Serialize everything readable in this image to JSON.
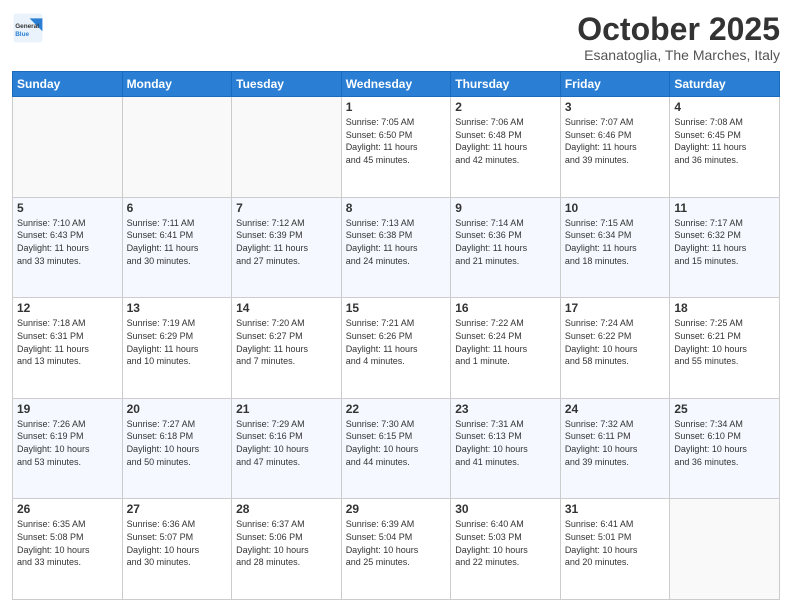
{
  "header": {
    "logo_general": "General",
    "logo_blue": "Blue",
    "month_title": "October 2025",
    "location": "Esanatoglia, The Marches, Italy"
  },
  "days_of_week": [
    "Sunday",
    "Monday",
    "Tuesday",
    "Wednesday",
    "Thursday",
    "Friday",
    "Saturday"
  ],
  "weeks": [
    [
      {
        "day": "",
        "info": ""
      },
      {
        "day": "",
        "info": ""
      },
      {
        "day": "",
        "info": ""
      },
      {
        "day": "1",
        "info": "Sunrise: 7:05 AM\nSunset: 6:50 PM\nDaylight: 11 hours\nand 45 minutes."
      },
      {
        "day": "2",
        "info": "Sunrise: 7:06 AM\nSunset: 6:48 PM\nDaylight: 11 hours\nand 42 minutes."
      },
      {
        "day": "3",
        "info": "Sunrise: 7:07 AM\nSunset: 6:46 PM\nDaylight: 11 hours\nand 39 minutes."
      },
      {
        "day": "4",
        "info": "Sunrise: 7:08 AM\nSunset: 6:45 PM\nDaylight: 11 hours\nand 36 minutes."
      }
    ],
    [
      {
        "day": "5",
        "info": "Sunrise: 7:10 AM\nSunset: 6:43 PM\nDaylight: 11 hours\nand 33 minutes."
      },
      {
        "day": "6",
        "info": "Sunrise: 7:11 AM\nSunset: 6:41 PM\nDaylight: 11 hours\nand 30 minutes."
      },
      {
        "day": "7",
        "info": "Sunrise: 7:12 AM\nSunset: 6:39 PM\nDaylight: 11 hours\nand 27 minutes."
      },
      {
        "day": "8",
        "info": "Sunrise: 7:13 AM\nSunset: 6:38 PM\nDaylight: 11 hours\nand 24 minutes."
      },
      {
        "day": "9",
        "info": "Sunrise: 7:14 AM\nSunset: 6:36 PM\nDaylight: 11 hours\nand 21 minutes."
      },
      {
        "day": "10",
        "info": "Sunrise: 7:15 AM\nSunset: 6:34 PM\nDaylight: 11 hours\nand 18 minutes."
      },
      {
        "day": "11",
        "info": "Sunrise: 7:17 AM\nSunset: 6:32 PM\nDaylight: 11 hours\nand 15 minutes."
      }
    ],
    [
      {
        "day": "12",
        "info": "Sunrise: 7:18 AM\nSunset: 6:31 PM\nDaylight: 11 hours\nand 13 minutes."
      },
      {
        "day": "13",
        "info": "Sunrise: 7:19 AM\nSunset: 6:29 PM\nDaylight: 11 hours\nand 10 minutes."
      },
      {
        "day": "14",
        "info": "Sunrise: 7:20 AM\nSunset: 6:27 PM\nDaylight: 11 hours\nand 7 minutes."
      },
      {
        "day": "15",
        "info": "Sunrise: 7:21 AM\nSunset: 6:26 PM\nDaylight: 11 hours\nand 4 minutes."
      },
      {
        "day": "16",
        "info": "Sunrise: 7:22 AM\nSunset: 6:24 PM\nDaylight: 11 hours\nand 1 minute."
      },
      {
        "day": "17",
        "info": "Sunrise: 7:24 AM\nSunset: 6:22 PM\nDaylight: 10 hours\nand 58 minutes."
      },
      {
        "day": "18",
        "info": "Sunrise: 7:25 AM\nSunset: 6:21 PM\nDaylight: 10 hours\nand 55 minutes."
      }
    ],
    [
      {
        "day": "19",
        "info": "Sunrise: 7:26 AM\nSunset: 6:19 PM\nDaylight: 10 hours\nand 53 minutes."
      },
      {
        "day": "20",
        "info": "Sunrise: 7:27 AM\nSunset: 6:18 PM\nDaylight: 10 hours\nand 50 minutes."
      },
      {
        "day": "21",
        "info": "Sunrise: 7:29 AM\nSunset: 6:16 PM\nDaylight: 10 hours\nand 47 minutes."
      },
      {
        "day": "22",
        "info": "Sunrise: 7:30 AM\nSunset: 6:15 PM\nDaylight: 10 hours\nand 44 minutes."
      },
      {
        "day": "23",
        "info": "Sunrise: 7:31 AM\nSunset: 6:13 PM\nDaylight: 10 hours\nand 41 minutes."
      },
      {
        "day": "24",
        "info": "Sunrise: 7:32 AM\nSunset: 6:11 PM\nDaylight: 10 hours\nand 39 minutes."
      },
      {
        "day": "25",
        "info": "Sunrise: 7:34 AM\nSunset: 6:10 PM\nDaylight: 10 hours\nand 36 minutes."
      }
    ],
    [
      {
        "day": "26",
        "info": "Sunrise: 6:35 AM\nSunset: 5:08 PM\nDaylight: 10 hours\nand 33 minutes."
      },
      {
        "day": "27",
        "info": "Sunrise: 6:36 AM\nSunset: 5:07 PM\nDaylight: 10 hours\nand 30 minutes."
      },
      {
        "day": "28",
        "info": "Sunrise: 6:37 AM\nSunset: 5:06 PM\nDaylight: 10 hours\nand 28 minutes."
      },
      {
        "day": "29",
        "info": "Sunrise: 6:39 AM\nSunset: 5:04 PM\nDaylight: 10 hours\nand 25 minutes."
      },
      {
        "day": "30",
        "info": "Sunrise: 6:40 AM\nSunset: 5:03 PM\nDaylight: 10 hours\nand 22 minutes."
      },
      {
        "day": "31",
        "info": "Sunrise: 6:41 AM\nSunset: 5:01 PM\nDaylight: 10 hours\nand 20 minutes."
      },
      {
        "day": "",
        "info": ""
      }
    ]
  ]
}
